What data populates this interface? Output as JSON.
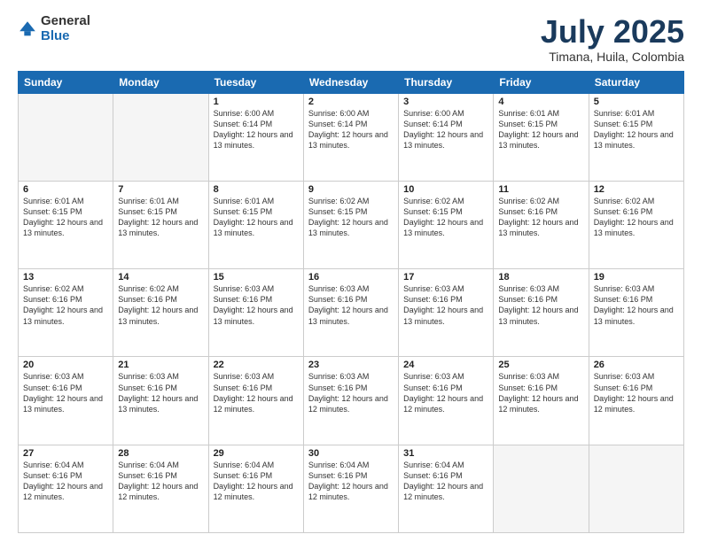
{
  "logo": {
    "general": "General",
    "blue": "Blue"
  },
  "header": {
    "month": "July 2025",
    "location": "Timana, Huila, Colombia"
  },
  "weekdays": [
    "Sunday",
    "Monday",
    "Tuesday",
    "Wednesday",
    "Thursday",
    "Friday",
    "Saturday"
  ],
  "weeks": [
    [
      {
        "day": "",
        "sunrise": "",
        "sunset": "",
        "daylight": ""
      },
      {
        "day": "",
        "sunrise": "",
        "sunset": "",
        "daylight": ""
      },
      {
        "day": "1",
        "sunrise": "Sunrise: 6:00 AM",
        "sunset": "Sunset: 6:14 PM",
        "daylight": "Daylight: 12 hours and 13 minutes."
      },
      {
        "day": "2",
        "sunrise": "Sunrise: 6:00 AM",
        "sunset": "Sunset: 6:14 PM",
        "daylight": "Daylight: 12 hours and 13 minutes."
      },
      {
        "day": "3",
        "sunrise": "Sunrise: 6:00 AM",
        "sunset": "Sunset: 6:14 PM",
        "daylight": "Daylight: 12 hours and 13 minutes."
      },
      {
        "day": "4",
        "sunrise": "Sunrise: 6:01 AM",
        "sunset": "Sunset: 6:15 PM",
        "daylight": "Daylight: 12 hours and 13 minutes."
      },
      {
        "day": "5",
        "sunrise": "Sunrise: 6:01 AM",
        "sunset": "Sunset: 6:15 PM",
        "daylight": "Daylight: 12 hours and 13 minutes."
      }
    ],
    [
      {
        "day": "6",
        "sunrise": "Sunrise: 6:01 AM",
        "sunset": "Sunset: 6:15 PM",
        "daylight": "Daylight: 12 hours and 13 minutes."
      },
      {
        "day": "7",
        "sunrise": "Sunrise: 6:01 AM",
        "sunset": "Sunset: 6:15 PM",
        "daylight": "Daylight: 12 hours and 13 minutes."
      },
      {
        "day": "8",
        "sunrise": "Sunrise: 6:01 AM",
        "sunset": "Sunset: 6:15 PM",
        "daylight": "Daylight: 12 hours and 13 minutes."
      },
      {
        "day": "9",
        "sunrise": "Sunrise: 6:02 AM",
        "sunset": "Sunset: 6:15 PM",
        "daylight": "Daylight: 12 hours and 13 minutes."
      },
      {
        "day": "10",
        "sunrise": "Sunrise: 6:02 AM",
        "sunset": "Sunset: 6:15 PM",
        "daylight": "Daylight: 12 hours and 13 minutes."
      },
      {
        "day": "11",
        "sunrise": "Sunrise: 6:02 AM",
        "sunset": "Sunset: 6:16 PM",
        "daylight": "Daylight: 12 hours and 13 minutes."
      },
      {
        "day": "12",
        "sunrise": "Sunrise: 6:02 AM",
        "sunset": "Sunset: 6:16 PM",
        "daylight": "Daylight: 12 hours and 13 minutes."
      }
    ],
    [
      {
        "day": "13",
        "sunrise": "Sunrise: 6:02 AM",
        "sunset": "Sunset: 6:16 PM",
        "daylight": "Daylight: 12 hours and 13 minutes."
      },
      {
        "day": "14",
        "sunrise": "Sunrise: 6:02 AM",
        "sunset": "Sunset: 6:16 PM",
        "daylight": "Daylight: 12 hours and 13 minutes."
      },
      {
        "day": "15",
        "sunrise": "Sunrise: 6:03 AM",
        "sunset": "Sunset: 6:16 PM",
        "daylight": "Daylight: 12 hours and 13 minutes."
      },
      {
        "day": "16",
        "sunrise": "Sunrise: 6:03 AM",
        "sunset": "Sunset: 6:16 PM",
        "daylight": "Daylight: 12 hours and 13 minutes."
      },
      {
        "day": "17",
        "sunrise": "Sunrise: 6:03 AM",
        "sunset": "Sunset: 6:16 PM",
        "daylight": "Daylight: 12 hours and 13 minutes."
      },
      {
        "day": "18",
        "sunrise": "Sunrise: 6:03 AM",
        "sunset": "Sunset: 6:16 PM",
        "daylight": "Daylight: 12 hours and 13 minutes."
      },
      {
        "day": "19",
        "sunrise": "Sunrise: 6:03 AM",
        "sunset": "Sunset: 6:16 PM",
        "daylight": "Daylight: 12 hours and 13 minutes."
      }
    ],
    [
      {
        "day": "20",
        "sunrise": "Sunrise: 6:03 AM",
        "sunset": "Sunset: 6:16 PM",
        "daylight": "Daylight: 12 hours and 13 minutes."
      },
      {
        "day": "21",
        "sunrise": "Sunrise: 6:03 AM",
        "sunset": "Sunset: 6:16 PM",
        "daylight": "Daylight: 12 hours and 13 minutes."
      },
      {
        "day": "22",
        "sunrise": "Sunrise: 6:03 AM",
        "sunset": "Sunset: 6:16 PM",
        "daylight": "Daylight: 12 hours and 12 minutes."
      },
      {
        "day": "23",
        "sunrise": "Sunrise: 6:03 AM",
        "sunset": "Sunset: 6:16 PM",
        "daylight": "Daylight: 12 hours and 12 minutes."
      },
      {
        "day": "24",
        "sunrise": "Sunrise: 6:03 AM",
        "sunset": "Sunset: 6:16 PM",
        "daylight": "Daylight: 12 hours and 12 minutes."
      },
      {
        "day": "25",
        "sunrise": "Sunrise: 6:03 AM",
        "sunset": "Sunset: 6:16 PM",
        "daylight": "Daylight: 12 hours and 12 minutes."
      },
      {
        "day": "26",
        "sunrise": "Sunrise: 6:03 AM",
        "sunset": "Sunset: 6:16 PM",
        "daylight": "Daylight: 12 hours and 12 minutes."
      }
    ],
    [
      {
        "day": "27",
        "sunrise": "Sunrise: 6:04 AM",
        "sunset": "Sunset: 6:16 PM",
        "daylight": "Daylight: 12 hours and 12 minutes."
      },
      {
        "day": "28",
        "sunrise": "Sunrise: 6:04 AM",
        "sunset": "Sunset: 6:16 PM",
        "daylight": "Daylight: 12 hours and 12 minutes."
      },
      {
        "day": "29",
        "sunrise": "Sunrise: 6:04 AM",
        "sunset": "Sunset: 6:16 PM",
        "daylight": "Daylight: 12 hours and 12 minutes."
      },
      {
        "day": "30",
        "sunrise": "Sunrise: 6:04 AM",
        "sunset": "Sunset: 6:16 PM",
        "daylight": "Daylight: 12 hours and 12 minutes."
      },
      {
        "day": "31",
        "sunrise": "Sunrise: 6:04 AM",
        "sunset": "Sunset: 6:16 PM",
        "daylight": "Daylight: 12 hours and 12 minutes."
      },
      {
        "day": "",
        "sunrise": "",
        "sunset": "",
        "daylight": ""
      },
      {
        "day": "",
        "sunrise": "",
        "sunset": "",
        "daylight": ""
      }
    ]
  ]
}
